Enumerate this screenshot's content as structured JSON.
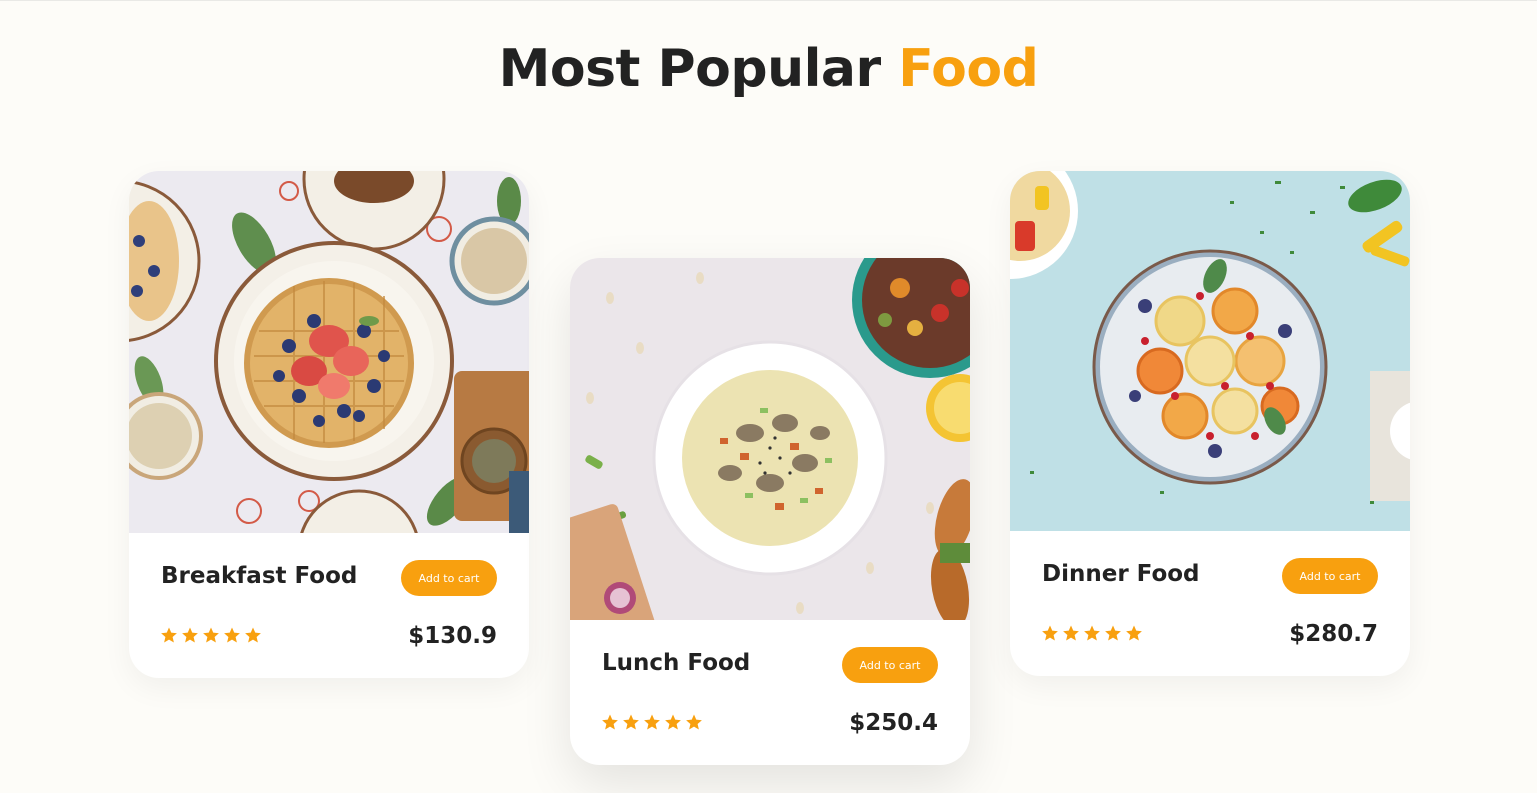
{
  "section": {
    "title_main": "Most Popular",
    "title_accent": "Food"
  },
  "colors": {
    "accent": "#f8a00f",
    "text": "#222222",
    "background": "#fdfcf8",
    "card": "#ffffff"
  },
  "cards": [
    {
      "name": "Breakfast Food",
      "button_label": "Add to cart",
      "rating": 5,
      "max_rating": 5,
      "price": "$130.9",
      "image": "waffles-with-berries-photo"
    },
    {
      "name": "Lunch Food",
      "button_label": "Add to cart",
      "rating": 5,
      "max_rating": 5,
      "price": "$250.4",
      "image": "clam-chowder-photo"
    },
    {
      "name": "Dinner Food",
      "button_label": "Add to cart",
      "rating": 5,
      "max_rating": 5,
      "price": "$280.7",
      "image": "citrus-salad-photo"
    }
  ]
}
